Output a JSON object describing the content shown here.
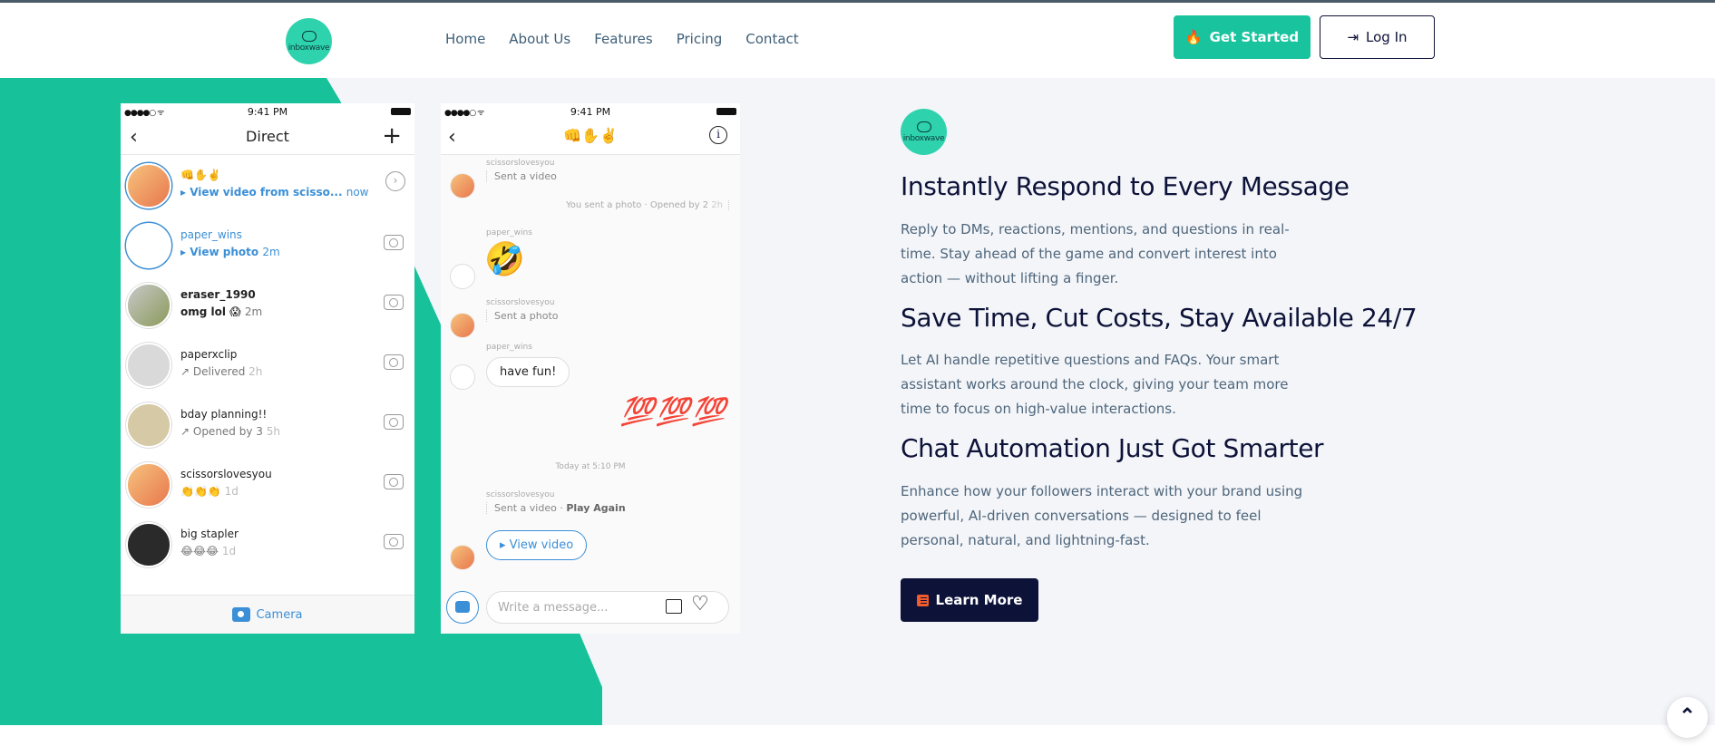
{
  "nav": {
    "logo_text": "inboxwave",
    "links": [
      "Home",
      "About Us",
      "Features",
      "Pricing",
      "Contact"
    ],
    "get_started": "Get Started",
    "login": "Log In"
  },
  "phone_inbox": {
    "time": "9:41 PM",
    "title": "Direct",
    "rows": [
      {
        "name": "👊✋✌️",
        "sub": "▸ View video from scisso...",
        "time": "now"
      },
      {
        "name": "paper_wins",
        "sub": "▸ View photo",
        "time": "2m"
      },
      {
        "name": "eraser_1990",
        "sub": "omg lol 😱",
        "time": "2m"
      },
      {
        "name": "paperxclip",
        "sub": "↗ Delivered",
        "time": "2h"
      },
      {
        "name": "bday planning!!",
        "sub": "↗ Opened by 3",
        "time": "5h"
      },
      {
        "name": "scissorslovesyou",
        "sub": "👏👏👏",
        "time": "1d"
      },
      {
        "name": "big stapler",
        "sub": "😂😂😂",
        "time": "1d"
      }
    ],
    "footer": "Camera"
  },
  "phone_chat": {
    "time": "9:41 PM",
    "title": "👊✋✌️",
    "sender1": "scissorslovesyou",
    "msg1": "Sent a video",
    "sent_photo": "You sent a photo · Opened by 2",
    "sent_photo_time": "2h",
    "sender2": "paper_wins",
    "emoji": "🤣",
    "sender3": "scissorslovesyou",
    "msg3": "Sent a photo",
    "sender4": "paper_wins",
    "msg4": "have fun!",
    "hundreds": "💯💯💯",
    "stamp": "Today at 5:10 PM",
    "sender5": "scissorslovesyou",
    "msg5": "Sent a video",
    "msg5_action": "Play Again",
    "view_video": "▸ View video",
    "placeholder": "Write a message..."
  },
  "content": {
    "h1": "Instantly Respond to Every Message",
    "p1": "Reply to DMs, reactions, mentions, and questions in real-time. Stay ahead of the game and convert interest into action — without lifting a finger.",
    "h2": "Save Time, Cut Costs, Stay Available 24/7",
    "p2": "Let AI handle repetitive questions and FAQs. Your smart assistant works around the clock, giving your team more time to focus on high-value interactions.",
    "h3": "Chat Automation Just Got Smarter",
    "p3": "Enhance how your followers interact with your brand using powerful, AI-driven conversations — designed to feel personal, natural, and lightning-fast.",
    "cta": "Learn More"
  },
  "colors": {
    "accent": "#19c39e",
    "navy": "#0d1238",
    "body_text": "#4f667b"
  },
  "icons": {
    "scroll_top": "chevron-up-icon"
  }
}
